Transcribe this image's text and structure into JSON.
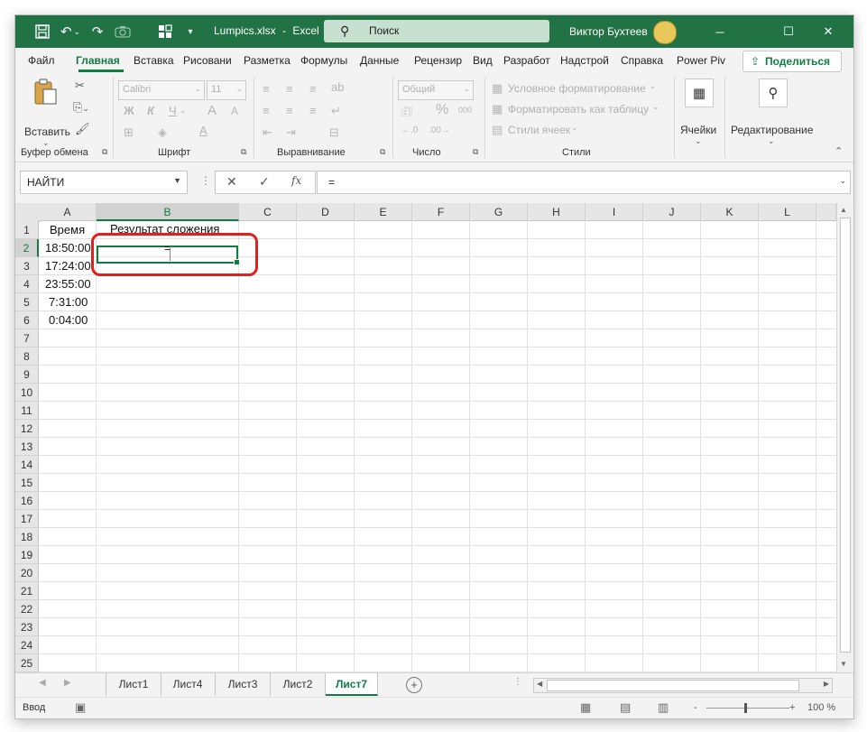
{
  "titlebar": {
    "filename": "Lumpics.xlsx",
    "separator": "-",
    "app": "Excel",
    "search_placeholder": "Поиск",
    "user_name": "Виктор Бухтеев",
    "bg_color": "#217346"
  },
  "menu": {
    "items": [
      "Файл",
      "Главная",
      "Вставка",
      "Рисовани",
      "Разметка",
      "Формулы",
      "Данные",
      "Рецензир",
      "Вид",
      "Разработ",
      "Надстрой",
      "Справка",
      "Power Piv"
    ],
    "active": "Главная",
    "share_label": "Поделиться"
  },
  "ribbon": {
    "clipboard": {
      "paste_label": "Вставить",
      "group_label": "Буфер обмена"
    },
    "font": {
      "font_name": "Calibri",
      "font_size": "11",
      "bold": "Ж",
      "italic": "К",
      "underline": "Ч",
      "grow": "A",
      "shrink": "A",
      "group_label": "Шрифт"
    },
    "alignment": {
      "group_label": "Выравнивание"
    },
    "number": {
      "format": "Общий",
      "percent": "%",
      "thousands": "000",
      "group_label": "Число"
    },
    "styles": {
      "conditional": "Условное форматирование",
      "as_table": "Форматировать как таблицу",
      "cell_styles": "Стили ячеек",
      "group_label": "Стили"
    },
    "cells": {
      "label": "Ячейки"
    },
    "editing": {
      "label": "Редактирование"
    }
  },
  "formula_bar": {
    "name_box": "НАЙТИ",
    "formula": "=",
    "fx": "fx"
  },
  "grid": {
    "columns": [
      "A",
      "B",
      "C",
      "D",
      "E",
      "F",
      "G",
      "H",
      "I",
      "J",
      "K",
      "L"
    ],
    "selected_column": "B",
    "rows": [
      "1",
      "2",
      "3",
      "4",
      "5",
      "6",
      "7",
      "8",
      "9",
      "10",
      "11",
      "12",
      "13",
      "14",
      "15",
      "16",
      "17",
      "18",
      "19",
      "20",
      "21",
      "22",
      "23",
      "24",
      "25"
    ],
    "selected_row": "2",
    "cells": {
      "A1": "Время",
      "B1": "Результат сложения",
      "A2": "18:50:00",
      "A3": "17:24:00",
      "A4": "23:55:00",
      "A5": "7:31:00",
      "A6": "0:04:00",
      "B2": "="
    },
    "highlight_color": "#e0201d"
  },
  "sheets": {
    "tabs": [
      "Лист1",
      "Лист4",
      "Лист3",
      "Лист2",
      "Лист7"
    ],
    "active": "Лист7",
    "add": "+"
  },
  "status": {
    "mode": "Ввод",
    "zoom_minus": "-",
    "zoom_plus": "+",
    "zoom": "100 %"
  }
}
